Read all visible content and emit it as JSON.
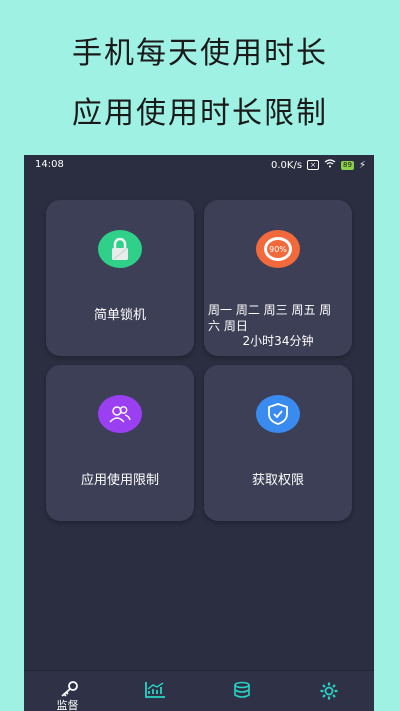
{
  "headline": {
    "line1": "手机每天使用时长",
    "line2": "应用使用时长限制"
  },
  "status_bar": {
    "time": "14:08",
    "speed": "0.0K/s",
    "battery": "89"
  },
  "cards": [
    {
      "label": "简单锁机",
      "icon": "lock-icon"
    },
    {
      "label_days": "周一 周二 周三 周五 周六 周日",
      "usage": "2小时34分钟",
      "icon_text": "90%",
      "icon": "progress-ring-icon"
    },
    {
      "label": "应用使用限制",
      "icon": "users-icon"
    },
    {
      "label": "获取权限",
      "icon": "shield-check-icon"
    }
  ],
  "nav": [
    {
      "label": "监督",
      "icon": "key-icon"
    },
    {
      "label": "",
      "icon": "chart-icon"
    },
    {
      "label": "",
      "icon": "database-icon"
    },
    {
      "label": "",
      "icon": "gear-icon"
    }
  ],
  "colors": {
    "background": "#9ff1e4",
    "phone_bg": "#2b2d40",
    "card_bg": "#3d3f56",
    "accent": "#27d4c4",
    "lock_green": "#2fd08a",
    "progress_orange": "#f26a3c",
    "users_purple": "#9b3ff3",
    "shield_blue": "#3a8bf0"
  }
}
